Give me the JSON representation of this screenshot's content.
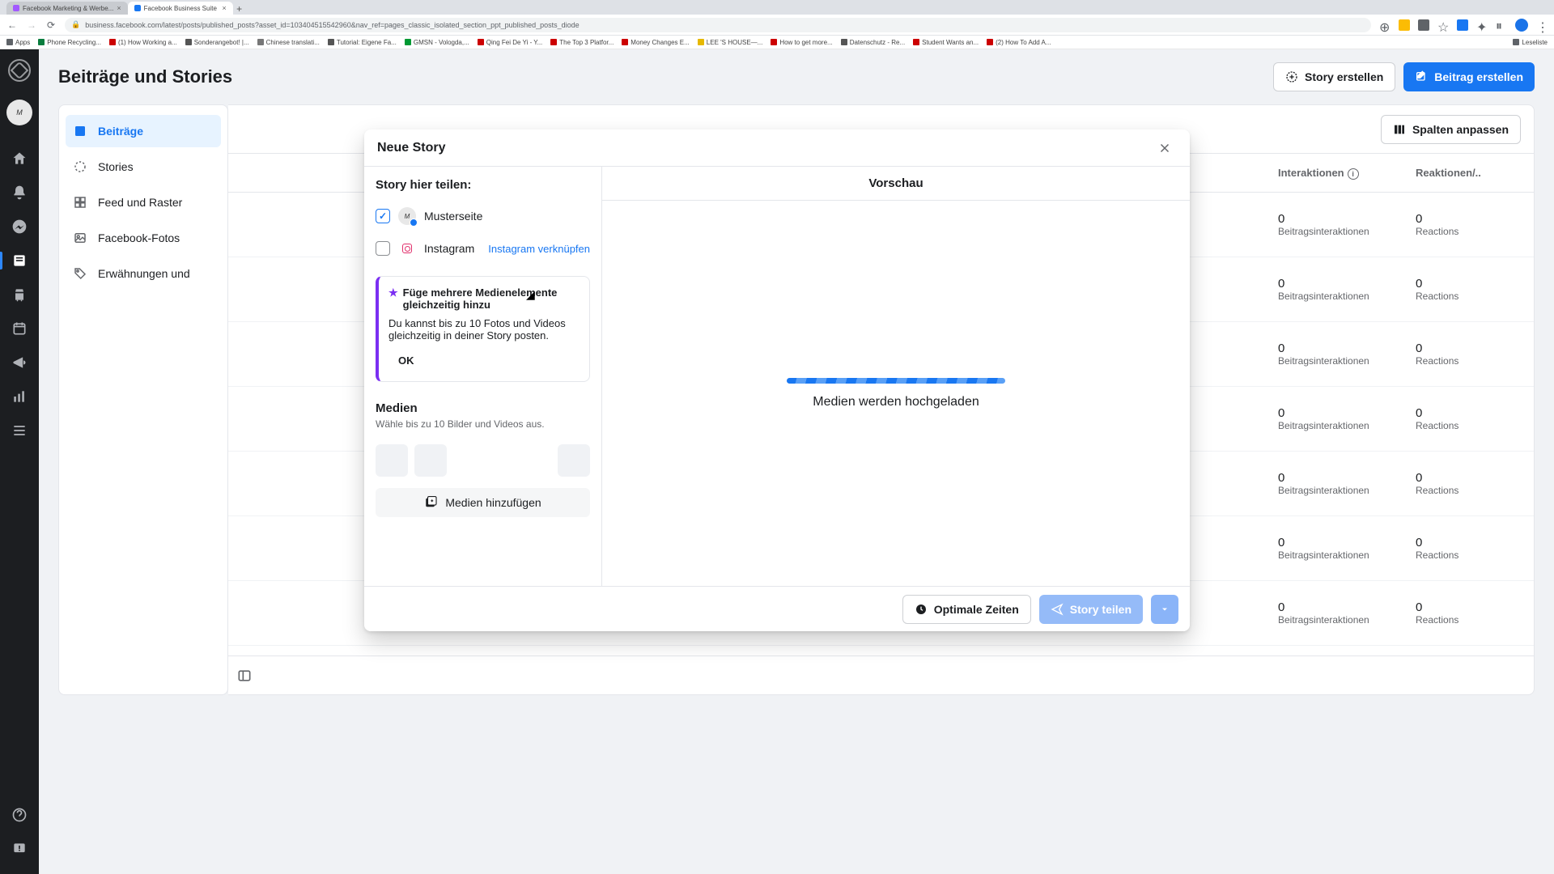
{
  "browser": {
    "tabs": [
      {
        "title": "Facebook Marketing & Werbe...",
        "favicon": "#a259ff"
      },
      {
        "title": "Facebook Business Suite",
        "favicon": "#1877f2"
      }
    ],
    "url": "business.facebook.com/latest/posts/published_posts?asset_id=103404515542960&nav_ref=pages_classic_isolated_section_ppt_published_posts_diode",
    "bookmarks": [
      {
        "label": "Apps",
        "color": "#5f6368"
      },
      {
        "label": "Phone Recycling...",
        "color": "#0a7d3e"
      },
      {
        "label": "(1) How Working a...",
        "color": "#cc0000"
      },
      {
        "label": "Sonderangebot! |...",
        "color": "#555"
      },
      {
        "label": "Chinese translati...",
        "color": "#777"
      },
      {
        "label": "Tutorial: Eigene Fa...",
        "color": "#555"
      },
      {
        "label": "GMSN - Vologda,...",
        "color": "#009933"
      },
      {
        "label": "Qing Fei De Yi - Y...",
        "color": "#cc0000"
      },
      {
        "label": "The Top 3 Platfor...",
        "color": "#cc0000"
      },
      {
        "label": "Money Changes E...",
        "color": "#cc0000"
      },
      {
        "label": "LEE 'S HOUSE—...",
        "color": "#e6b800"
      },
      {
        "label": "How to get more...",
        "color": "#cc0000"
      },
      {
        "label": "Datenschutz - Re...",
        "color": "#555"
      },
      {
        "label": "Student Wants an...",
        "color": "#cc0000"
      },
      {
        "label": "(2) How To Add A...",
        "color": "#cc0000"
      }
    ],
    "reading_list": "Leseliste"
  },
  "header": {
    "title": "Beiträge und Stories",
    "create_story": "Story erstellen",
    "create_post": "Beitrag erstellen"
  },
  "sidebar": {
    "items": [
      {
        "label": "Beiträge"
      },
      {
        "label": "Stories"
      },
      {
        "label": "Feed und Raster"
      },
      {
        "label": "Facebook-Fotos"
      },
      {
        "label": "Erwähnungen und"
      }
    ]
  },
  "table": {
    "adjust_columns": "Spalten anpassen",
    "col_interactions": "Interaktionen",
    "col_reactions": "Reaktionen/..",
    "rows": [
      {
        "a": "0",
        "asub": "Beitragsinteraktionen",
        "b": "0",
        "bsub": "Reactions"
      },
      {
        "a": "0",
        "asub": "Beitragsinteraktionen",
        "b": "0",
        "bsub": "Reactions"
      },
      {
        "a": "0",
        "asub": "Beitragsinteraktionen",
        "b": "0",
        "bsub": "Reactions"
      },
      {
        "a": "0",
        "asub": "Beitragsinteraktionen",
        "b": "0",
        "bsub": "Reactions"
      },
      {
        "a": "0",
        "asub": "Beitragsinteraktionen",
        "b": "0",
        "bsub": "Reactions"
      },
      {
        "a": "0",
        "asub": "Beitragsinteraktionen",
        "b": "0",
        "bsub": "Reactions"
      },
      {
        "a": "0",
        "asub": "Beitragsinteraktionen",
        "b": "0",
        "bsub": "Reactions"
      }
    ]
  },
  "modal": {
    "title": "Neue Story",
    "share_heading": "Story hier teilen:",
    "page_name": "Musterseite",
    "instagram": "Instagram",
    "link_instagram": "Instagram verknüpfen",
    "tip_title": "Füge mehrere Medienelemente gleichzeitig hinzu",
    "tip_body": "Du kannst bis zu 10 Fotos und Videos gleichzeitig in deiner Story posten.",
    "tip_ok": "OK",
    "media_heading": "Medien",
    "media_sub": "Wähle bis zu 10 Bilder und Videos aus.",
    "add_media": "Medien hinzufügen",
    "preview": "Vorschau",
    "uploading": "Medien werden hochgeladen",
    "optimal_times": "Optimale Zeiten",
    "share_story": "Story teilen"
  }
}
